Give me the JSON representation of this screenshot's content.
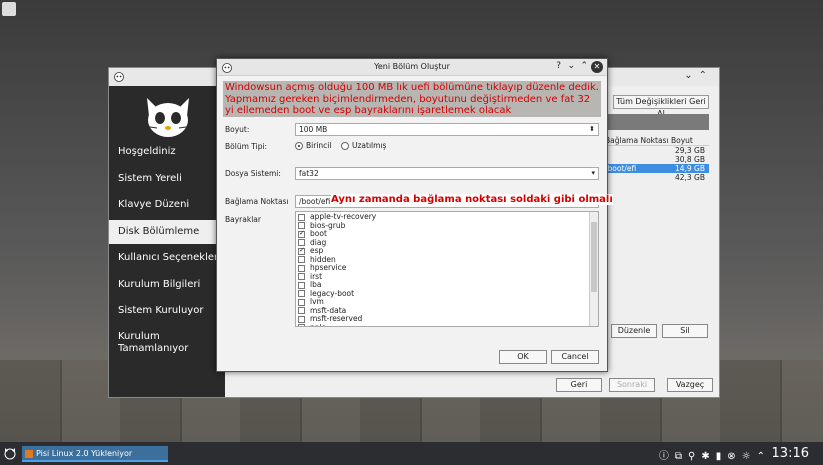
{
  "installer": {
    "sidebar": [
      {
        "label": "Hoşgeldiniz",
        "active": false
      },
      {
        "label": "Sistem Yereli",
        "active": false
      },
      {
        "label": "Klavye Düzeni",
        "active": false
      },
      {
        "label": "Disk Bölümleme",
        "active": true
      },
      {
        "label": "Kullanıcı Seçenekleri",
        "active": false
      },
      {
        "label": "Kurulum Bilgileri",
        "active": false
      },
      {
        "label": "Sistem Kuruluyor",
        "active": false
      },
      {
        "label": "Kurulum Tamamlanıyor",
        "active": false
      }
    ],
    "revert_all": "Tüm Değişiklikleri Geri Al",
    "table": {
      "col_mount": "Bağlama Noktası",
      "col_size": "Boyut",
      "rows": [
        {
          "mount": "",
          "size": "29,3 GB"
        },
        {
          "mount": "",
          "size": "30,8 GB"
        },
        {
          "mount": "/boot/efi",
          "size": "14,9 GB",
          "selected": true
        },
        {
          "mount": "",
          "size": "42,3 GB"
        }
      ]
    },
    "edit_btn": "Düzenle",
    "delete_btn": "Sil",
    "back_btn": "Geri",
    "next_btn": "Sonraki",
    "cancel_btn": "Vazgeç"
  },
  "dialog": {
    "title": "Yeni Bölüm Oluştur",
    "annotation_top": "Windowsun açmış olduğu 100 MB lık uefi bölümüne tıklayıp düzenle dedik. Yapmamız gereken biçimlendirmeden, boyutunu değiştirmeden ve fat 32 yi ellemeden boot ve esp bayraklarını işaretlemek olacak",
    "size_label": "Boyut:",
    "size_value": "100 MB",
    "type_label": "Bölüm Tipi:",
    "type_primary": "Birincil",
    "type_extended": "Uzatılmış",
    "fs_label": "Dosya Sistemi:",
    "fs_value": "fat32",
    "mount_label": "Bağlama Noktası",
    "mount_value": "/boot/efi",
    "annotation_mount": "Aynı zamanda bağlama noktası soldaki gibi olmalı",
    "flags_label": "Bayraklar",
    "flags": [
      {
        "name": "apple-tv-recovery",
        "checked": false
      },
      {
        "name": "bios-grub",
        "checked": false
      },
      {
        "name": "boot",
        "checked": true
      },
      {
        "name": "diag",
        "checked": false
      },
      {
        "name": "esp",
        "checked": true
      },
      {
        "name": "hidden",
        "checked": false
      },
      {
        "name": "hpservice",
        "checked": false
      },
      {
        "name": "irst",
        "checked": false
      },
      {
        "name": "lba",
        "checked": false
      },
      {
        "name": "legacy-boot",
        "checked": false
      },
      {
        "name": "lvm",
        "checked": false
      },
      {
        "name": "msft-data",
        "checked": false
      },
      {
        "name": "msft-reserved",
        "checked": false
      },
      {
        "name": "palo",
        "checked": false
      }
    ],
    "ok": "OK",
    "cancel": "Cancel"
  },
  "taskbar": {
    "app_label": "Pisi Linux 2.0 Yükleniyor",
    "clock": "13:16"
  }
}
